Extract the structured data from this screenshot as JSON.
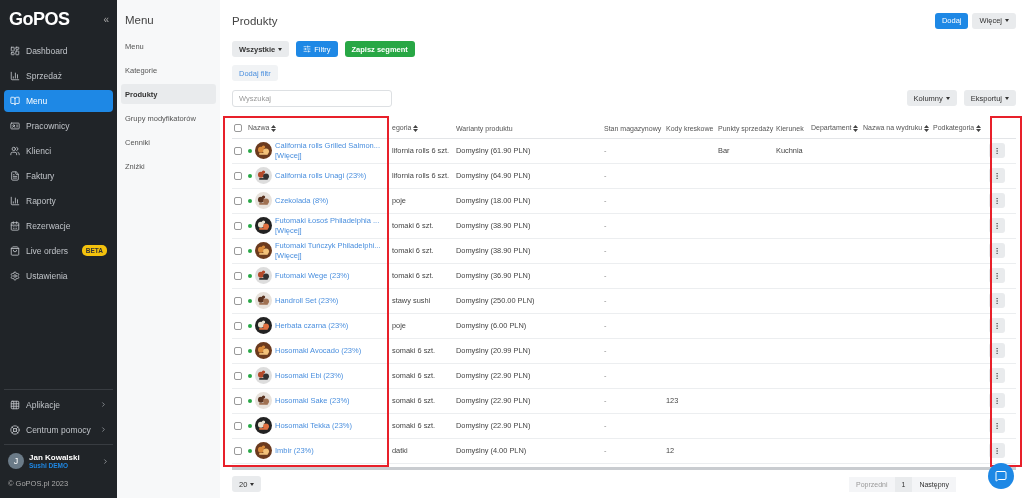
{
  "sidebar": {
    "logo": "GoPOS",
    "collapse": "«",
    "items": [
      {
        "label": "Dashboard",
        "selected": false
      },
      {
        "label": "Sprzedaż",
        "selected": false
      },
      {
        "label": "Menu",
        "selected": true
      },
      {
        "label": "Pracownicy",
        "selected": false
      },
      {
        "label": "Klienci",
        "selected": false
      },
      {
        "label": "Faktury",
        "selected": false
      },
      {
        "label": "Raporty",
        "selected": false
      },
      {
        "label": "Rezerwacje",
        "selected": false
      },
      {
        "label": "Live orders",
        "selected": false,
        "badge": "BETA"
      },
      {
        "label": "Ustawienia",
        "selected": false
      }
    ],
    "bottom_items": [
      {
        "label": "Aplikacje"
      },
      {
        "label": "Centrum pomocy"
      }
    ],
    "user": {
      "initial": "J",
      "name": "Jan Kowalski",
      "venue": "Sushi DEMO"
    },
    "copyright": "© GoPOS.pl 2023"
  },
  "submenu": {
    "title": "Menu",
    "items": [
      {
        "label": "Menu",
        "selected": false
      },
      {
        "label": "Kategorie",
        "selected": false
      },
      {
        "label": "Produkty",
        "selected": true
      },
      {
        "label": "Grupy modyfikatorów",
        "selected": false
      },
      {
        "label": "Cenniki",
        "selected": false
      },
      {
        "label": "Zniżki",
        "selected": false
      }
    ]
  },
  "page": {
    "title": "Produkty",
    "add_button": "Dodaj",
    "more_button": "Więcej",
    "segment": "Wszystkie",
    "filters_button": "Filtry",
    "save_segment_button": "Zapisz segment",
    "add_filter_button": "Dodaj filtr",
    "search": {
      "placeholder": "Wyszukaj"
    },
    "columns_button": "Kolumny",
    "export_button": "Eksportuj"
  },
  "table": {
    "all_checked": false,
    "columns": [
      {
        "label": "Nazwa",
        "sortable": true
      },
      {
        "label": "egoria",
        "sortable": true
      },
      {
        "label": "Warianty produktu",
        "sortable": false
      },
      {
        "label": "Stan magazynowy",
        "sortable": false
      },
      {
        "label": "Kody kreskowe",
        "sortable": false
      },
      {
        "label": "Punkty sprzedaży",
        "sortable": false
      },
      {
        "label": "Kierunek",
        "sortable": false
      },
      {
        "label": "Departament",
        "sortable": true
      },
      {
        "label": "Nazwa na wydruku",
        "sortable": true
      },
      {
        "label": "Podkategoria",
        "sortable": true
      }
    ],
    "rows": [
      {
        "checked": false,
        "active": true,
        "more": "[Więcej]",
        "cells": [
          "California rolls Grilled Salmon...",
          "lifornia rolls 6 szt.",
          "Domyślny (61.90 PLN)",
          "-",
          "",
          "Bar",
          "Kuchnia",
          "",
          "",
          ""
        ]
      },
      {
        "checked": false,
        "active": true,
        "cells": [
          "California rolls Unagi (23%)",
          "lifornia rolls 6 szt.",
          "Domyślny (64.90 PLN)",
          "-",
          "",
          "",
          "",
          "",
          "",
          ""
        ]
      },
      {
        "checked": false,
        "active": true,
        "cells": [
          "Czekolada (8%)",
          "poje",
          "Domyślny (18.00 PLN)",
          "-",
          "",
          "",
          "",
          "",
          "",
          ""
        ]
      },
      {
        "checked": false,
        "active": true,
        "more": "[Więcej]",
        "cells": [
          "Futomaki Łosoś Philadelphia ...",
          "tomaki 6 szt.",
          "Domyślny (38.90 PLN)",
          "-",
          "",
          "",
          "",
          "",
          "",
          ""
        ]
      },
      {
        "checked": false,
        "active": true,
        "more": "[Więcej]",
        "cells": [
          "Futomaki Tuńczyk Philadelphi...",
          "tomaki 6 szt.",
          "Domyślny (38.90 PLN)",
          "-",
          "",
          "",
          "",
          "",
          "",
          ""
        ]
      },
      {
        "checked": false,
        "active": true,
        "cells": [
          "Futomaki Wege (23%)",
          "tomaki 6 szt.",
          "Domyślny (36.90 PLN)",
          "-",
          "",
          "",
          "",
          "",
          "",
          ""
        ]
      },
      {
        "checked": false,
        "active": true,
        "cells": [
          "Handroll Set (23%)",
          "stawy sushi",
          "Domyślny (250.00 PLN)",
          "-",
          "",
          "",
          "",
          "",
          "",
          ""
        ]
      },
      {
        "checked": false,
        "active": true,
        "cells": [
          "Herbata czarna (23%)",
          "poje",
          "Domyślny (6.00 PLN)",
          "-",
          "",
          "",
          "",
          "",
          "",
          ""
        ]
      },
      {
        "checked": false,
        "active": true,
        "cells": [
          "Hosomaki Avocado (23%)",
          "somaki 6 szt.",
          "Domyślny (20.99 PLN)",
          "-",
          "",
          "",
          "",
          "",
          "",
          ""
        ]
      },
      {
        "checked": false,
        "active": true,
        "cells": [
          "Hosomaki Ebi (23%)",
          "somaki 6 szt.",
          "Domyślny (22.90 PLN)",
          "-",
          "",
          "",
          "",
          "",
          "",
          ""
        ]
      },
      {
        "checked": false,
        "active": true,
        "cells": [
          "Hosomaki Sake (23%)",
          "somaki 6 szt.",
          "Domyślny (22.90 PLN)",
          "-",
          "123",
          "",
          "",
          "",
          "",
          ""
        ]
      },
      {
        "checked": false,
        "active": true,
        "cells": [
          "Hosomaki Tekka (23%)",
          "somaki 6 szt.",
          "Domyślny (22.90 PLN)",
          "-",
          "",
          "",
          "",
          "",
          "",
          ""
        ]
      },
      {
        "checked": false,
        "active": true,
        "cells": [
          "Imbir (23%)",
          "datki",
          "Domyślny (4.00 PLN)",
          "-",
          "12",
          "",
          "",
          "",
          "",
          ""
        ]
      }
    ]
  },
  "footer": {
    "page_size": "20",
    "previous": "Poprzedni",
    "page": "1",
    "next": "Następny"
  }
}
